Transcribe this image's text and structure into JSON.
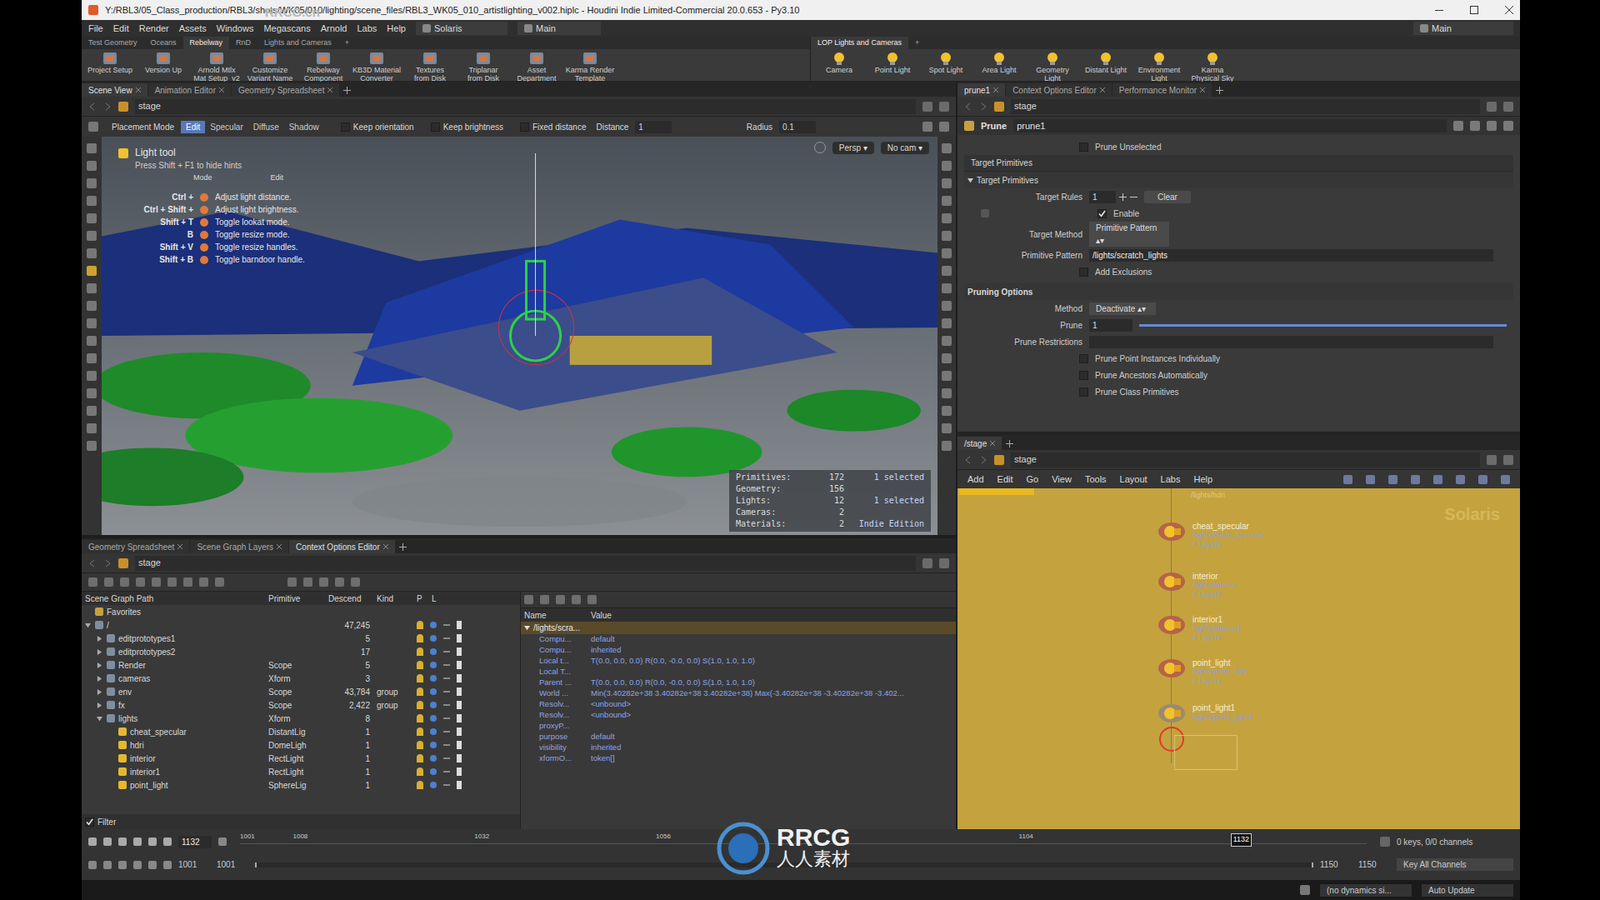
{
  "window": {
    "title": "Y:/RBL3/05_Class_production/RBL3/shots/WK05/010/lighting/scene_files/RBL3_WK05_010_artistlighting_v002.hiplc - Houdini Indie Limited-Commercial 20.0.653 - Py3.10",
    "watermark": "RRCG.cn"
  },
  "menubar": {
    "menus": [
      "File",
      "Edit",
      "Render",
      "Assets",
      "Windows",
      "Megascans",
      "Arnold",
      "Labs",
      "Help"
    ],
    "desktop": "Solaris",
    "context": "Main",
    "right_desktop": "Main"
  },
  "shelf_left": {
    "tabs": [
      {
        "label": "Test Geometry",
        "selected": false
      },
      {
        "label": "Oceans",
        "selected": false
      },
      {
        "label": "Rebelway",
        "selected": true
      },
      {
        "label": "RnD",
        "selected": false
      },
      {
        "label": "Lights and Cameras",
        "selected": false
      },
      {
        "label": "+",
        "selected": false
      }
    ],
    "tools": [
      [
        "Project Setup"
      ],
      [
        "Version Up"
      ],
      [
        "Arnold Mtlx",
        "Mat Setup_v2"
      ],
      [
        "Customize",
        "Variant Name"
      ],
      [
        "Rebelway",
        "Component"
      ],
      [
        "KB3D Material",
        "Converter"
      ],
      [
        "Textures",
        "from Disk"
      ],
      [
        "Triplanar",
        "from Disk"
      ],
      [
        "Asset",
        "Department"
      ],
      [
        "Karma Render",
        "Template"
      ]
    ]
  },
  "shelf_right": {
    "tabs": [
      {
        "label": "LOP Lights and Cameras",
        "selected": true
      },
      {
        "label": "+",
        "selected": false
      }
    ],
    "tools": [
      [
        "Camera"
      ],
      [
        "Point Light"
      ],
      [
        "Spot Light"
      ],
      [
        "Area Light"
      ],
      [
        "Geometry",
        "Light"
      ],
      [
        "Distant Light"
      ],
      [
        "Environment",
        "Light"
      ],
      [
        "Karma",
        "Physical Sky"
      ]
    ]
  },
  "scene_view": {
    "tabs": [
      {
        "label": "Scene View",
        "selected": true
      },
      {
        "label": "Animation Editor",
        "selected": false
      },
      {
        "label": "Geometry Spreadsheet",
        "selected": false
      }
    ],
    "path": "stage",
    "toolbar": {
      "label": "Placement Mode",
      "modes": [
        {
          "label": "Edit",
          "selected": true
        },
        {
          "label": "Specular",
          "selected": false
        },
        {
          "label": "Diffuse",
          "selected": false
        },
        {
          "label": "Shadow",
          "selected": false
        }
      ],
      "checks": [
        {
          "label": "Keep orientation",
          "checked": false
        },
        {
          "label": "Keep brightness",
          "checked": false
        },
        {
          "label": "Fixed distance",
          "checked": false
        }
      ],
      "distance_label": "Distance",
      "distance": "1",
      "radius_label": "Radius",
      "radius": "0.1"
    },
    "hints": {
      "title": "Light tool",
      "subtitle": "Press Shift + F1 to hide hints",
      "mode_label": "Mode",
      "mode_value": "Edit",
      "items": [
        {
          "keys": "Ctrl +",
          "text": "Adjust light distance."
        },
        {
          "keys": "Ctrl + Shift +",
          "text": "Adjust light brightness."
        },
        {
          "keys": "Shift + T",
          "text": "Toggle lookat mode."
        },
        {
          "keys": "B",
          "text": "Toggle resize mode."
        },
        {
          "keys": "Shift + V",
          "text": "Toggle resize handles."
        },
        {
          "keys": "Shift + B",
          "text": "Toggle barndoor handle."
        }
      ]
    },
    "camera": "Persp",
    "cam_menu": "No cam",
    "stats": [
      {
        "label": "Primitives:",
        "value": "172",
        "note": "1 selected"
      },
      {
        "label": "Geometry:",
        "value": "156",
        "note": ""
      },
      {
        "label": "Lights:",
        "value": "12",
        "note": "1 selected"
      },
      {
        "label": "Cameras:",
        "value": "2",
        "note": ""
      },
      {
        "label": "Materials:",
        "value": "2",
        "note": "Indie Edition"
      }
    ]
  },
  "scene_graph": {
    "tabs": [
      {
        "label": "Geometry Spreadsheet",
        "selected": false
      },
      {
        "label": "Scene Graph Layers",
        "selected": false
      },
      {
        "label": "Context Options Editor",
        "selected": true
      }
    ],
    "path": "stage",
    "columns": [
      "Scene Graph Path",
      "Primitive",
      "Descend",
      "Kind",
      "P",
      "L"
    ],
    "rows": [
      {
        "name": "Favorites",
        "primitive": "",
        "descend": "",
        "kind_text": "",
        "depth": 0,
        "kind": "folder",
        "expandable": false,
        "expanded": false
      },
      {
        "name": "/",
        "primitive": "",
        "descend": "47,245",
        "kind_text": "",
        "depth": 0,
        "kind": "root",
        "expandable": true,
        "expanded": true
      },
      {
        "name": "editprototypes1",
        "primitive": "",
        "descend": "5",
        "kind_text": "",
        "depth": 1,
        "kind": "group",
        "expandable": true,
        "expanded": false
      },
      {
        "name": "editprototypes2",
        "primitive": "",
        "descend": "17",
        "kind_text": "",
        "depth": 1,
        "kind": "group",
        "expandable": true,
        "expanded": false
      },
      {
        "name": "Render",
        "primitive": "Scope",
        "descend": "5",
        "kind_text": "",
        "depth": 1,
        "kind": "group",
        "expandable": true,
        "expanded": false
      },
      {
        "name": "cameras",
        "primitive": "Xform",
        "descend": "3",
        "kind_text": "",
        "depth": 1,
        "kind": "group",
        "expandable": true,
        "expanded": false
      },
      {
        "name": "env",
        "primitive": "Scope",
        "descend": "43,784",
        "kind_text": "group",
        "depth": 1,
        "kind": "group",
        "expandable": true,
        "expanded": false
      },
      {
        "name": "fx",
        "primitive": "Scope",
        "descend": "2,422",
        "kind_text": "group",
        "depth": 1,
        "kind": "group",
        "expandable": true,
        "expanded": false
      },
      {
        "name": "lights",
        "primitive": "Xform",
        "descend": "8",
        "kind_text": "",
        "depth": 1,
        "kind": "group",
        "expandable": true,
        "expanded": true
      },
      {
        "name": "cheat_specular",
        "primitive": "DistantLig",
        "descend": "1",
        "kind_text": "",
        "depth": 2,
        "kind": "light",
        "expandable": false,
        "expanded": false
      },
      {
        "name": "hdri",
        "primitive": "DomeLigh",
        "descend": "1",
        "kind_text": "",
        "depth": 2,
        "kind": "light",
        "expandable": false,
        "expanded": false
      },
      {
        "name": "interior",
        "primitive": "RectLight",
        "descend": "1",
        "kind_text": "",
        "depth": 2,
        "kind": "light",
        "expandable": false,
        "expanded": false
      },
      {
        "name": "interior1",
        "primitive": "RectLight",
        "descend": "1",
        "kind_text": "",
        "depth": 2,
        "kind": "light",
        "expandable": false,
        "expanded": false
      },
      {
        "name": "point_light",
        "primitive": "SphereLig",
        "descend": "1",
        "kind_text": "",
        "depth": 2,
        "kind": "light",
        "expandable": false,
        "expanded": false
      }
    ],
    "filter": "Filter",
    "props_columns": [
      "Name",
      "Value"
    ],
    "props_header": "/lights/scra...",
    "props": [
      {
        "name": "Compu...",
        "value": "default"
      },
      {
        "name": "Compu...",
        "value": "inherited"
      },
      {
        "name": "Local t...",
        "value": "T(0.0, 0.0, 0.0) R(0.0, -0.0, 0.0) S(1.0, 1.0, 1.0)"
      },
      {
        "name": "Local T...",
        "value": ""
      },
      {
        "name": "Parent ...",
        "value": "T(0.0, 0.0, 0.0) R(0.0, -0.0, 0.0) S(1.0, 1.0, 1.0)"
      },
      {
        "name": "World ...",
        "value": "Min(3.40282e+38 3.40282e+38 3.40282e+38) Max(-3.40282e+38 -3.40282e+38 -3.402..."
      },
      {
        "name": "Resolv...",
        "value": "<unbound>"
      },
      {
        "name": "Resolv...",
        "value": "<unbound>"
      },
      {
        "name": "proxyP...",
        "value": ""
      },
      {
        "name": "purpose",
        "value": "default"
      },
      {
        "name": "visibility",
        "value": "inherited"
      },
      {
        "name": "xformO...",
        "value": "token[]"
      }
    ]
  },
  "params": {
    "tabs": [
      {
        "label": "prune1",
        "selected": true
      },
      {
        "label": "Context Options Editor",
        "selected": false
      },
      {
        "label": "Performance Monitor",
        "selected": false
      }
    ],
    "path": "stage",
    "node_type": "Prune",
    "node_name": "prune1",
    "prune_unselected": {
      "label": "Prune Unselected",
      "checked": false
    },
    "tab": "Target Primitives",
    "folder": "Target Primitives",
    "target_rules_label": "Target Rules",
    "target_rules": "1",
    "clear": "Clear",
    "enable": {
      "label": "Enable",
      "checked": true
    },
    "target_method_label": "Target Method",
    "target_method": "Primitive Pattern",
    "pattern_label": "Primitive Pattern",
    "pattern": "/lights/scratch_lights",
    "add_exclusions": {
      "label": "Add Exclusions",
      "checked": false
    },
    "pruning_header": "Pruning Options",
    "method_label": "Method",
    "method": "Deactivate",
    "prune_label": "Prune",
    "prune_value": "1",
    "prune_level": 1,
    "restrictions_label": "Prune Restrictions",
    "options": [
      {
        "label": "Prune Point Instances Individually",
        "checked": false
      },
      {
        "label": "Prune Ancestors Automatically",
        "checked": false
      },
      {
        "label": "Prune Class Primitives",
        "checked": false
      }
    ]
  },
  "network": {
    "tabs": [
      {
        "label": "/stage",
        "selected": true
      }
    ],
    "path": "stage",
    "menus": [
      "Add",
      "Edit",
      "Go",
      "View",
      "Tools",
      "Layout",
      "Labs",
      "Help"
    ],
    "watermark": "Solaris",
    "top_label": "/lights/hdri",
    "nodes": [
      {
        "name": "cheat_specular",
        "path": "/lights/cheat_specular",
        "layers": "4 Layers",
        "selected": false
      },
      {
        "name": "interior",
        "path": "/lights/interior",
        "layers": "4 Layers",
        "selected": false
      },
      {
        "name": "interior1",
        "path": "/lights/interior1",
        "layers": "4 Layers",
        "selected": false
      },
      {
        "name": "point_light",
        "path": "/lights/point_light",
        "layers": "4 Layers",
        "selected": false
      },
      {
        "name": "point_light1",
        "path": "/lights/point_light1",
        "layers": "",
        "selected": true
      }
    ]
  },
  "timeline": {
    "frame": "1132",
    "start": 1001,
    "end": 1150,
    "ticks": [
      "1001",
      "1008",
      "1032",
      "1056",
      "1104"
    ],
    "cursor": "1132",
    "cursor_value": 1132,
    "range_start": "1001",
    "range_start2": "1001",
    "range_end": "1150",
    "range_end2": "1150",
    "keys": "0 keys, 0/0 channels",
    "key_all": "Key All Channels",
    "auto_update": "Auto Update",
    "dynamics": "(no dynamics si..."
  },
  "overlay": {
    "logo": "RRCG",
    "logo_sub": "人人素材"
  }
}
